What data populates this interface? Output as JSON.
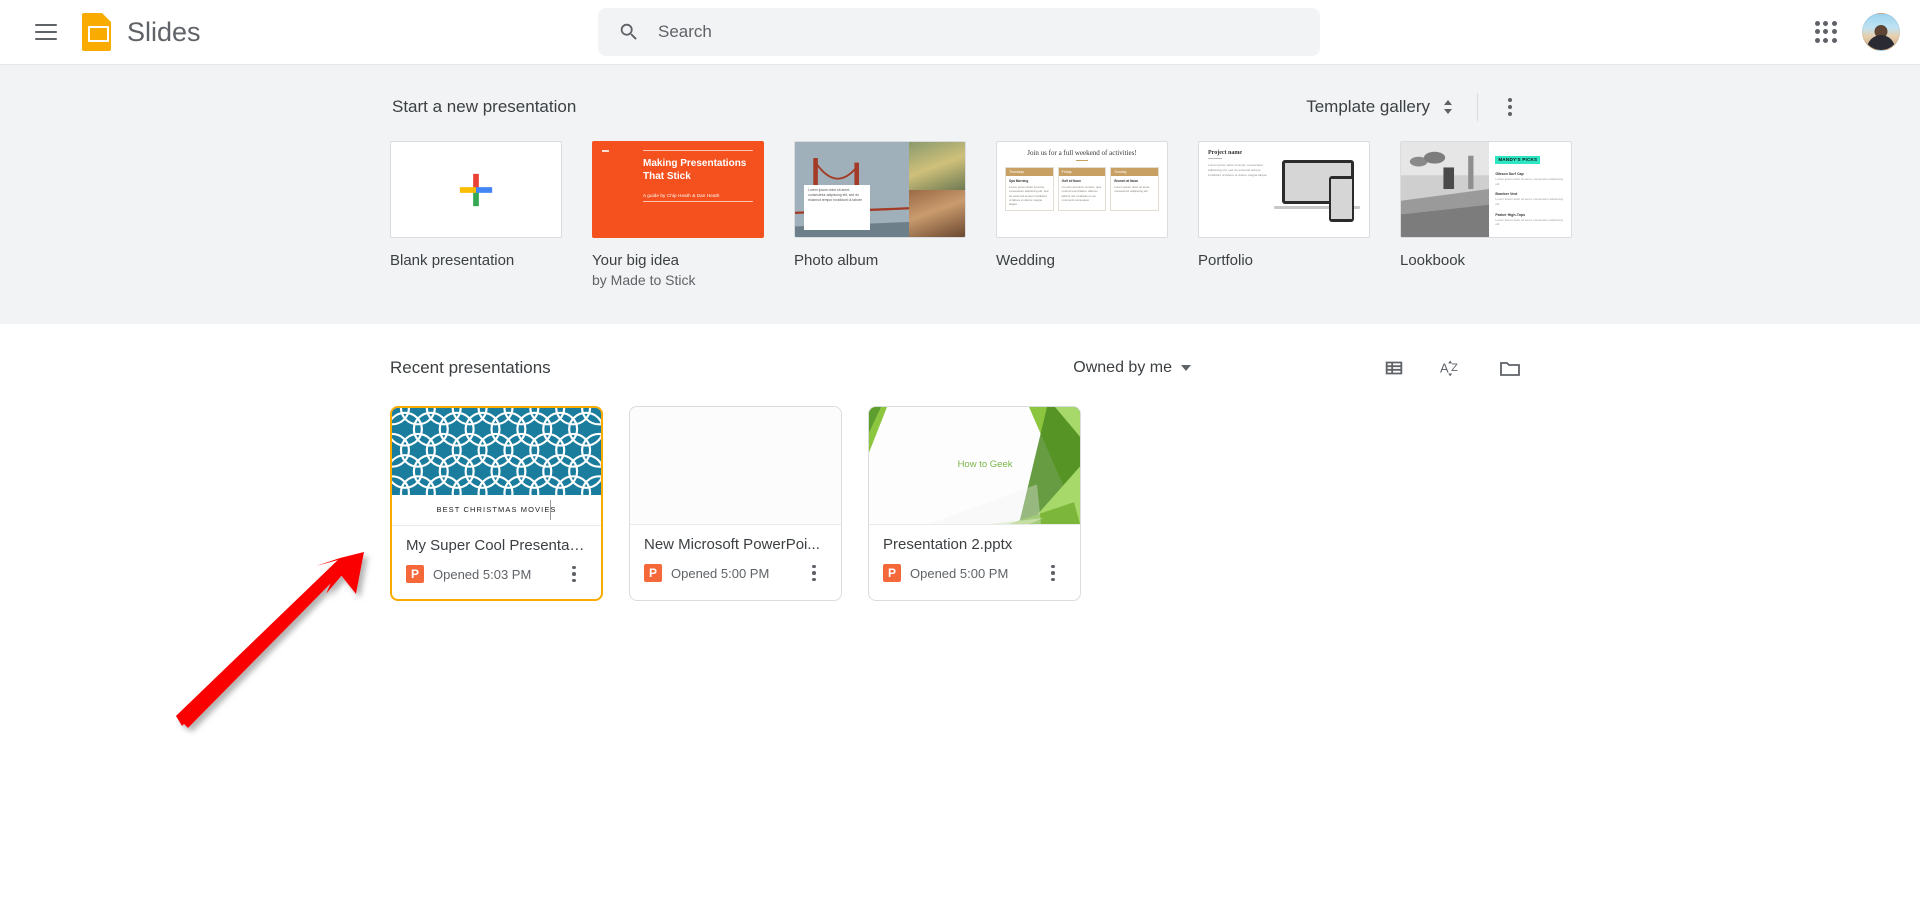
{
  "header": {
    "menu_label": "Main menu",
    "product_name": "Slides",
    "search_placeholder": "Search",
    "search_value": "",
    "apps_label": "Google apps",
    "avatar_label": "Google Account"
  },
  "templates": {
    "section_title": "Start a new presentation",
    "gallery_label": "Template gallery",
    "more_label": "More options",
    "items": [
      {
        "label": "Blank presentation",
        "sublabel": "",
        "thumb": "blank-plus"
      },
      {
        "label": "Your big idea",
        "sublabel": "by Made to Stick",
        "thumb": "big-idea",
        "thumb_text": {
          "title": "Making Presentations That Stick",
          "credit": "A guide by Chip Heath & Dan Heath"
        }
      },
      {
        "label": "Photo album",
        "sublabel": "",
        "thumb": "photo-album",
        "thumb_text": {
          "caption": "Lorem ipsum dolor sit amet, consectetur adipiscing elit, sed do eiusmod tempor incididunt ut labore"
        }
      },
      {
        "label": "Wedding",
        "sublabel": "",
        "thumb": "wedding",
        "thumb_text": {
          "title": "Join us for a full weekend of activities!",
          "columns": [
            {
              "day": "Thursday",
              "heading": "Spa Morning",
              "body": "Lorem ipsum dolor sit amet, consectetur adipiscing elit, sed do eiusmod tempor incididunt ut labore et dolore magna aliqua."
            },
            {
              "day": "Friday",
              "heading": "Golf at Noon",
              "body": "Ut enim ad minim veniam, quis nostrud exercitation ullamco laboris nisi ut aliquip ex ea commodo consequat."
            },
            {
              "day": "Sunday",
              "heading": "Brunch at Noon",
              "body": "Lorem ipsum dolor sit amet, consectetur adipiscing elit."
            }
          ]
        }
      },
      {
        "label": "Portfolio",
        "sublabel": "",
        "thumb": "portfolio",
        "thumb_text": {
          "title": "Project name",
          "body": "Lorem ipsum dolor sit amet, consectetur adipiscing elit, sed do eiusmod tempor incididunt ut labore et dolore magna aliqua."
        }
      },
      {
        "label": "Lookbook",
        "sublabel": "",
        "thumb": "lookbook",
        "thumb_text": {
          "badge": "MANDY'S PICKS",
          "items": [
            {
              "name": "Gibson Surf Cap",
              "body": "Lorem ipsum dolor sit amet, consectetur adipiscing elit"
            },
            {
              "name": "Bomber Vest",
              "body": "Lorem ipsum dolor sit amet, consectetur adipiscing elit"
            },
            {
              "name": "Parker High-Tops",
              "body": "Lorem ipsum dolor sit amet, consectetur adipiscing elit"
            }
          ]
        }
      }
    ]
  },
  "recent": {
    "section_title": "Recent presentations",
    "owner_filter": "Owned by me",
    "list_view_label": "List view",
    "sort_label": "Sort options",
    "folder_label": "Open file picker",
    "cards": [
      {
        "title": "My Super Cool Presentati...",
        "time": "Opened 5:03 PM",
        "file_type_badge": "P",
        "selected": true,
        "thumb": "christmas-pattern",
        "thumb_caption": "BEST CHRISTMAS MOVIES",
        "menu_label": "More actions"
      },
      {
        "title": "New Microsoft PowerPoi...",
        "time": "Opened 5:00 PM",
        "file_type_badge": "P",
        "selected": false,
        "thumb": "blank",
        "thumb_caption": "",
        "menu_label": "More actions"
      },
      {
        "title": "Presentation 2.pptx",
        "time": "Opened 5:00 PM",
        "file_type_badge": "P",
        "selected": false,
        "thumb": "green-facet",
        "thumb_caption": "How to Geek",
        "menu_label": "More actions"
      }
    ]
  },
  "annotation": {
    "type": "arrow",
    "color": "#fb0000",
    "points_to": "My Super Cool Presentati... card"
  },
  "colors": {
    "brand_yellow": "#f9ab00",
    "selected_border": "#f9ab00",
    "ppt_orange": "#f4683a",
    "section_bg": "#f1f3f4",
    "annotation_red": "#fb0000"
  }
}
